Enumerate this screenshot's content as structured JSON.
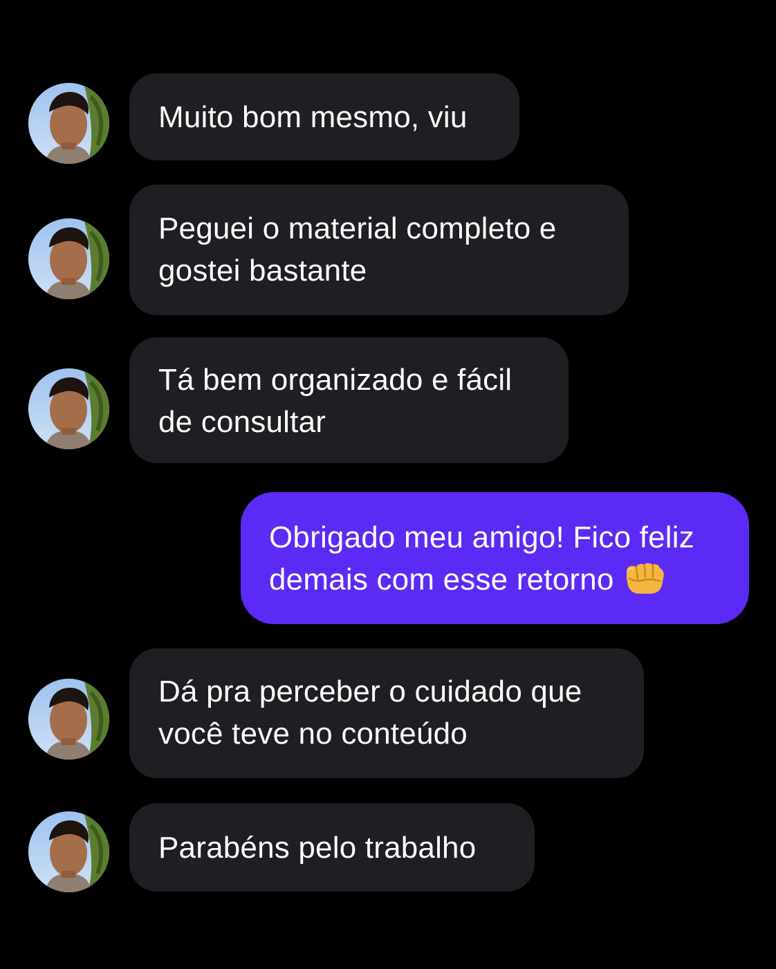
{
  "conversation": {
    "messages": [
      {
        "from": "contact",
        "lines": [
          "Muito bom mesmo, viu"
        ]
      },
      {
        "from": "contact",
        "lines": [
          "Peguei o material completo e",
          "gostei bastante"
        ]
      },
      {
        "from": "contact",
        "lines": [
          "Tá bem organizado e fácil",
          "de consultar"
        ]
      },
      {
        "from": "me",
        "lines": [
          "Obrigado meu amigo! Fico feliz",
          "demais com esse retorno"
        ],
        "emoji": "oncoming-fist-icon"
      },
      {
        "from": "contact",
        "lines": [
          "Dá pra perceber o cuidado que",
          "você teve no conteúdo"
        ]
      },
      {
        "from": "contact",
        "lines": [
          "Parabéns pelo trabalho"
        ]
      }
    ]
  },
  "colors": {
    "background": "#000000",
    "incoming_bubble": "#1f1f23",
    "outgoing_bubble": "#5b2bf5",
    "text": "#ffffff"
  }
}
